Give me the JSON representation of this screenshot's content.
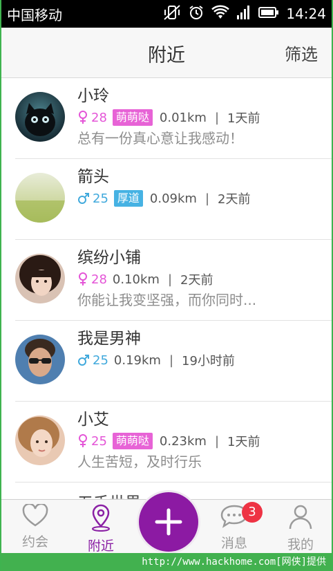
{
  "status_bar": {
    "carrier": "中国移动",
    "time": "14:24"
  },
  "header": {
    "title": "附近",
    "filter_label": "筛选"
  },
  "users": [
    {
      "name": "小玲",
      "gender": "female",
      "age": "28",
      "tag": "萌萌哒",
      "tag_color": "#e763d6",
      "distance": "0.01km",
      "time": "1天前",
      "bio": "总有一份真心意让我感动！"
    },
    {
      "name": "箭头",
      "gender": "male",
      "age": "25",
      "tag": "厚道",
      "tag_color": "#46b2e3",
      "distance": "0.09km",
      "time": "2天前",
      "bio": ""
    },
    {
      "name": "缤纷小铺",
      "gender": "female",
      "age": "28",
      "tag": "",
      "tag_color": "",
      "distance": "0.10km",
      "time": "2天前",
      "bio": "你能让我变坚强，而你同时..."
    },
    {
      "name": "我是男神",
      "gender": "male",
      "age": "25",
      "tag": "",
      "tag_color": "",
      "distance": "0.19km",
      "time": "19小时前",
      "bio": ""
    },
    {
      "name": "小艾",
      "gender": "female",
      "age": "25",
      "tag": "萌萌哒",
      "tag_color": "#e763d6",
      "distance": "0.23km",
      "time": "1天前",
      "bio": "人生苦短，及时行乐"
    }
  ],
  "partial_row_name": "五千世界",
  "bottom_nav": {
    "items": [
      {
        "label": "约会",
        "icon": "heart-icon"
      },
      {
        "label": "附近",
        "icon": "location-pin-icon",
        "active": true
      },
      {
        "label": "消息",
        "icon": "chat-bubble-icon",
        "badge": "3"
      },
      {
        "label": "我的",
        "icon": "person-icon"
      }
    ],
    "fab_icon": "plus-icon"
  },
  "watermark": "http://www.hackhome.com[网侠]提供",
  "colors": {
    "accent": "#8c1aa3",
    "female": "#e455d7",
    "male": "#40a9dc"
  }
}
